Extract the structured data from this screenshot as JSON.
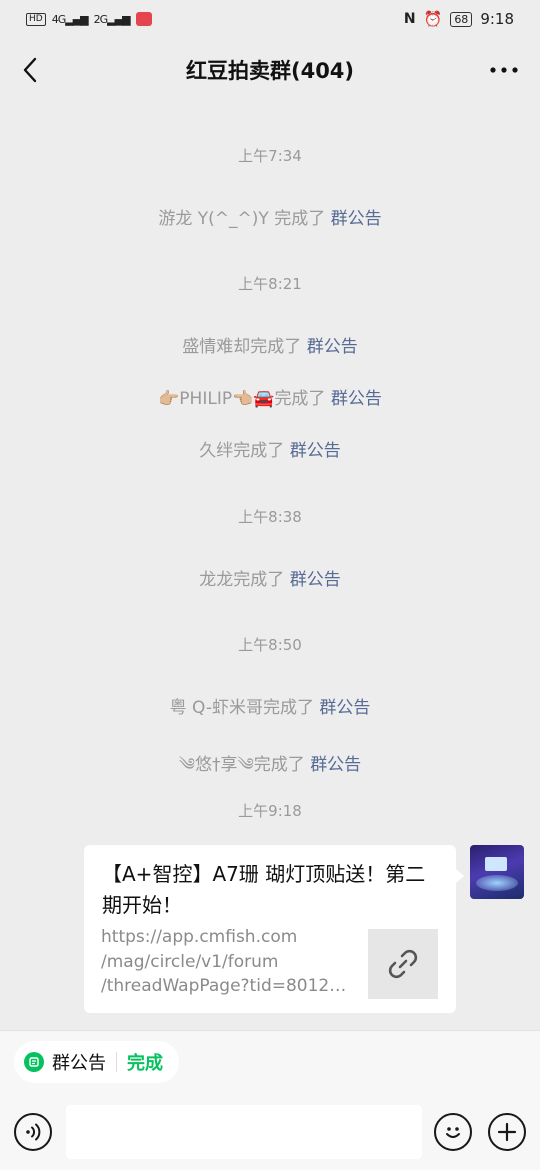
{
  "status_bar": {
    "hd_label": "HD",
    "net1": "4G",
    "net2": "2G",
    "battery": "68",
    "time": "9:18"
  },
  "header": {
    "title": "红豆拍卖群(404)"
  },
  "chat": {
    "timestamps": [
      "上午7:34",
      "上午8:21",
      "上午8:38",
      "上午8:50",
      "上午9:18"
    ],
    "system_messages": [
      {
        "name": "游龙 Y(^_^)Y",
        "action": "完成了",
        "link": "群公告"
      },
      {
        "name": "盛情难却",
        "action": "完成了",
        "link": "群公告"
      },
      {
        "name": "👉🏼PHILIP👈🏼🚘",
        "action": "完成了",
        "link": "群公告"
      },
      {
        "name": "久绊",
        "action": "完成了",
        "link": "群公告"
      },
      {
        "name": "龙龙",
        "action": "完成了",
        "link": "群公告"
      },
      {
        "name": "粤 Q-虾米哥",
        "action": "完成了",
        "link": "群公告"
      },
      {
        "name": "༄悠†享༄",
        "action": "完成了",
        "link": "群公告"
      }
    ],
    "link_card": {
      "title": "【A+智控】A7珊 瑚灯顶贴送！第二期开始！",
      "url_lines": [
        "https://app.cmfish.com",
        "/mag/circle/v1/forum",
        "/threadWapPage?tid=80121…"
      ],
      "thumb_icon": "link-icon"
    }
  },
  "bottom_bar": {
    "notice_label": "群公告",
    "done_label": "完成",
    "input_placeholder": ""
  },
  "colors": {
    "link": "#576b95",
    "accent_green": "#07c160",
    "background": "#ededed"
  }
}
